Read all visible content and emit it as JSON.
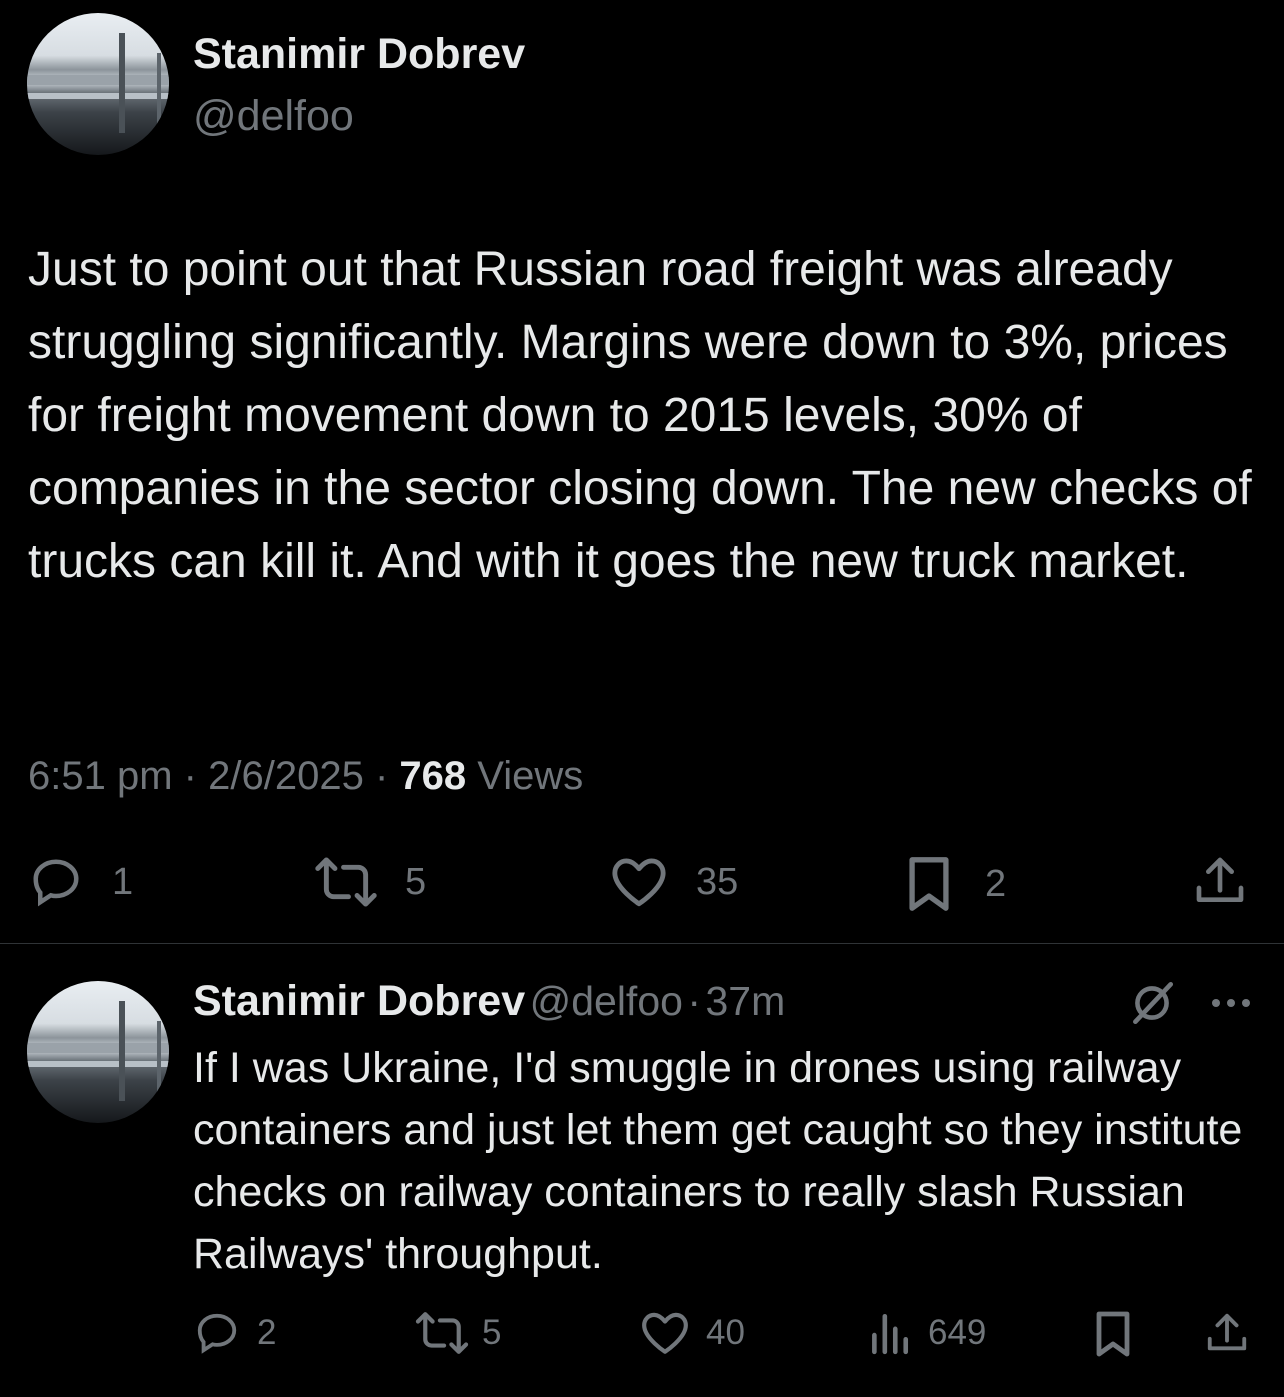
{
  "main_tweet": {
    "author_name": "Stanimir Dobrev",
    "handle": "@delfoo",
    "text": "Just to point out that Russian road freight was already struggling significantly. Margins were down to 3%, prices for freight movement down to 2015 levels, 30% of companies in the sector closing down. The new checks of trucks can kill it. And with it goes the new truck market.",
    "time": "6:51 pm",
    "separator": "·",
    "date": "2/6/2025",
    "views_count": "768",
    "views_label": "Views",
    "actions": {
      "replies": "1",
      "reposts": "5",
      "likes": "35",
      "bookmarks": "2"
    }
  },
  "reply_tweet": {
    "author_name": "Stanimir Dobrev",
    "handle": "@delfoo",
    "separator": "·",
    "age": "37m",
    "text": "If I was Ukraine, I'd smuggle in drones using railway containers and just let them get caught so they institute checks on railway containers to really slash Russian Railways' throughput.",
    "actions": {
      "replies": "2",
      "reposts": "5",
      "likes": "40",
      "views": "649"
    }
  },
  "icons": [
    "reply-icon",
    "repost-icon",
    "like-icon",
    "bookmark-icon",
    "share-icon",
    "views-icon",
    "grok-icon",
    "more-icon"
  ],
  "colors": {
    "background": "#000000",
    "text": "#e7e9ea",
    "muted": "#71767b",
    "divider": "#2f3336"
  }
}
